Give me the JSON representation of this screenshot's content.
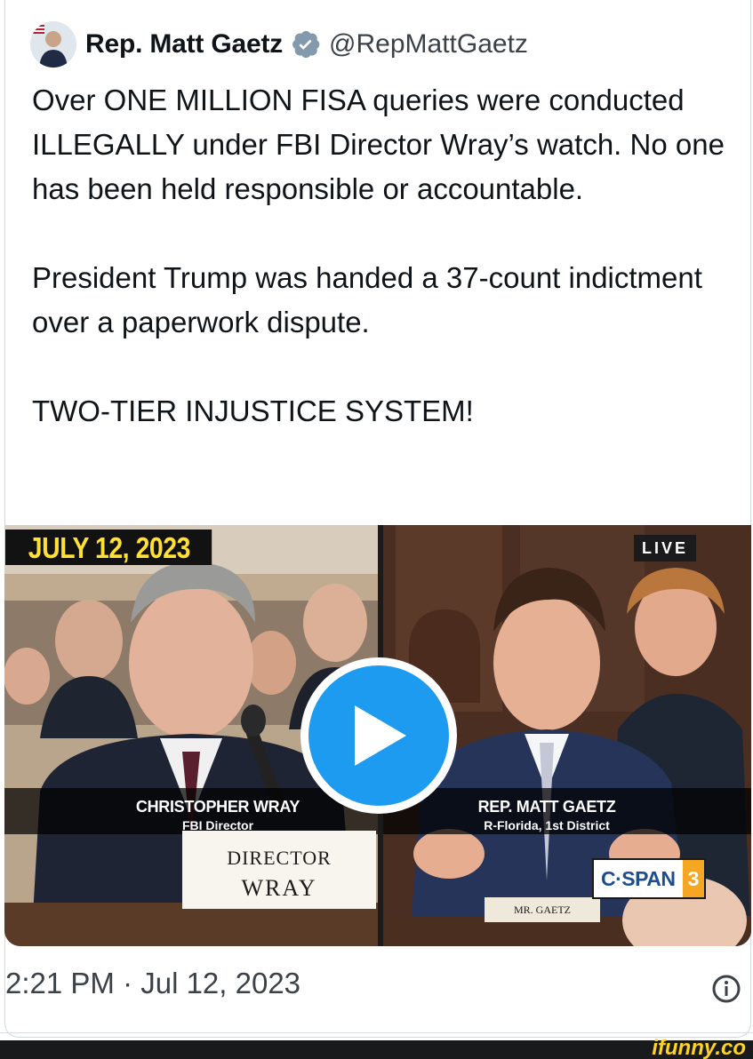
{
  "tweet": {
    "author_name": "Rep. Matt Gaetz",
    "author_handle": "@RepMattGaetz",
    "text": "Over ONE MILLION FISA queries were conducted ILLEGALLY under FBI Director Wray’s watch. No one has been held responsible or accountable.\n\nPresident Trump was handed a 37-count indictment over a paperwork dispute.\n\nTWO-TIER INJUSTICE SYSTEM!",
    "timestamp": "2:21 PM · Jul 12, 2023"
  },
  "media": {
    "date_badge": "JULY 12, 2023",
    "live_badge": "LIVE",
    "left_lower_third": {
      "name": "CHRISTOPHER WRAY",
      "title": "FBI Director"
    },
    "right_lower_third": {
      "name": "REP. MATT GAETZ",
      "title": "R-Florida, 1st District"
    },
    "placard_left": {
      "line1": "DIRECTOR",
      "line2": "WRAY"
    },
    "placard_right": "MR. GAETZ",
    "network_logo": {
      "text": "C·SPAN",
      "number": "3"
    }
  },
  "icons": {
    "verified": "verified-badge-icon",
    "play": "play-icon",
    "info": "info-icon"
  },
  "colors": {
    "accent": "#1d9bf0",
    "date_badge_text": "#ffe033",
    "watermark": "#ffd224"
  },
  "watermark": "ifunny.co"
}
